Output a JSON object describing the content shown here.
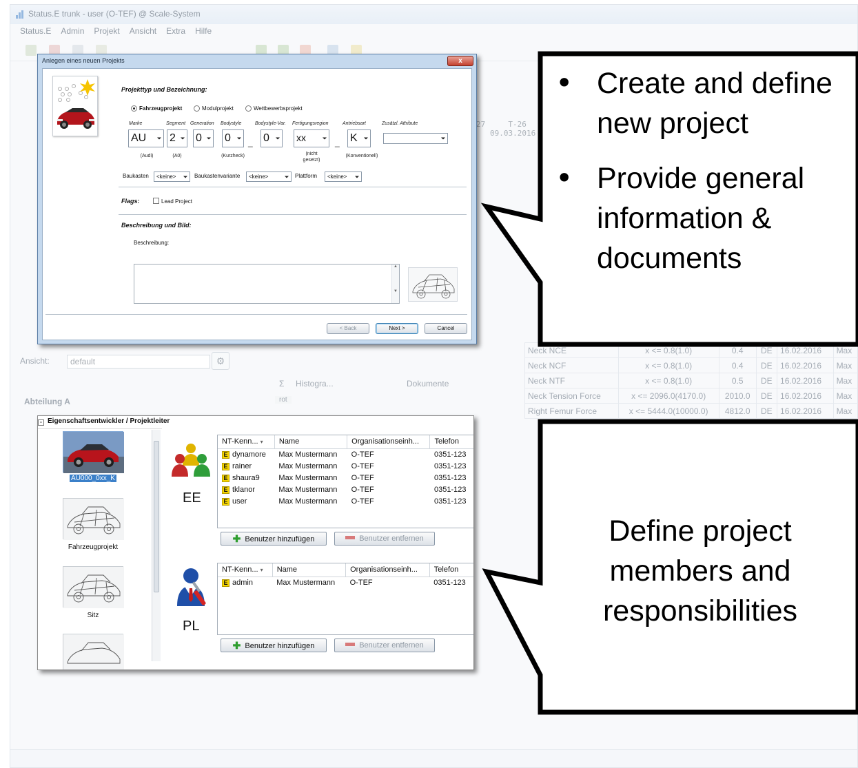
{
  "bg_app": {
    "title": "Status.E trunk - user (O-TEF) @ Scale-System",
    "menu": [
      "Status.E",
      "Admin",
      "Projekt",
      "Ansicht",
      "Extra",
      "Hilfe"
    ],
    "ansicht_label": "Ansicht:",
    "ansicht_value": "default",
    "columns": {
      "sum": "Σ",
      "histogram": "Histogra...",
      "documents": "Dokumente"
    },
    "department": "Abteilung A",
    "rot_label": "rot",
    "date_headers": [
      "27",
      "T-26"
    ],
    "date_value": "09.03.2016",
    "rows": [
      {
        "name": "Neck NCE",
        "range": "x <= 0.8(1.0)",
        "value": "0.4",
        "country": "DE",
        "date": "16.02.2016",
        "extra": "Max"
      },
      {
        "name": "Neck NCF",
        "range": "x <= 0.8(1.0)",
        "value": "0.4",
        "country": "DE",
        "date": "16.02.2016",
        "extra": "Max"
      },
      {
        "name": "Neck NTF",
        "range": "x <= 0.8(1.0)",
        "value": "0.5",
        "country": "DE",
        "date": "16.02.2016",
        "extra": "Max"
      },
      {
        "name": "Neck Tension Force",
        "range": "x <= 2096.0(4170.0)",
        "value": "2010.0",
        "country": "DE",
        "date": "16.02.2016",
        "extra": "Max"
      },
      {
        "name": "Right Femur Force",
        "range": "x <= 5444.0(10000.0)",
        "value": "4812.0",
        "country": "DE",
        "date": "16.02.2016",
        "extra": "Max"
      }
    ]
  },
  "dialog": {
    "title": "Anlegen eines neuen Projekts",
    "close_label": "x",
    "section_type": "Projekttyp und Bezeichnung:",
    "radio_options": [
      "Fahrzeugprojekt",
      "Modulprojekt",
      "Wettbewerbsprojekt"
    ],
    "field_labels": [
      "Marke",
      "Segment",
      "Generation",
      "Bodystyle",
      "Bodystyle-Var.",
      "Fertigungsregion",
      "Antriebsart",
      "Zusätzl. Attribute"
    ],
    "field_values": [
      "AU",
      "2",
      "0",
      "0",
      "0",
      "xx",
      "K",
      ""
    ],
    "field_hints": [
      "(Audi)",
      "(A0)",
      "(Kurzheck)",
      "(nicht gesetzt)",
      "(Konventionell)"
    ],
    "baukasten_label": "Baukasten",
    "baukasten_value": "<keine>",
    "baukastenvariante_label": "Baukastenvariante",
    "baukastenvariante_value": "<keine>",
    "plattform_label": "Plattform",
    "plattform_value": "<keine>",
    "flags_label": "Flags:",
    "lead_project_label": "Lead Project",
    "section_desc": "Beschreibung und Bild:",
    "description_label": "Beschreibung:",
    "buttons": {
      "back": "< Back",
      "next": "Next >",
      "cancel": "Cancel"
    }
  },
  "members_panel": {
    "title": "Eigenschaftsentwickler / Projektleiter",
    "thumbnails": [
      "AU000_0xx_K",
      "Fahrzeugprojekt",
      "Sitz"
    ],
    "roles": [
      "EE",
      "PL"
    ],
    "grid_columns": [
      "NT-Kenn...",
      "Name",
      "Organisationseinh...",
      "Telefon"
    ],
    "ee_members": [
      {
        "id": "dynamore",
        "name": "Max Mustermann",
        "org": "O-TEF",
        "phone": "0351-123"
      },
      {
        "id": "rainer",
        "name": "Max Mustermann",
        "org": "O-TEF",
        "phone": "0351-123"
      },
      {
        "id": "shaura9",
        "name": "Max Mustermann",
        "org": "O-TEF",
        "phone": "0351-123"
      },
      {
        "id": "tklanor",
        "name": "Max Mustermann",
        "org": "O-TEF",
        "phone": "0351-123"
      },
      {
        "id": "user",
        "name": "Max Mustermann",
        "org": "O-TEF",
        "phone": "0351-123"
      }
    ],
    "pl_members": [
      {
        "id": "admin",
        "name": "Max Mustermann",
        "org": "O-TEF",
        "phone": "0351-123"
      }
    ],
    "add_user_label": "Benutzer hinzufügen",
    "remove_user_label": "Benutzer entfernen",
    "badge_letter": "E"
  },
  "callouts": {
    "top_bullets": [
      "Create and define new project",
      "Provide general information & documents"
    ],
    "bottom_text": "Define project members and responsibilities"
  }
}
